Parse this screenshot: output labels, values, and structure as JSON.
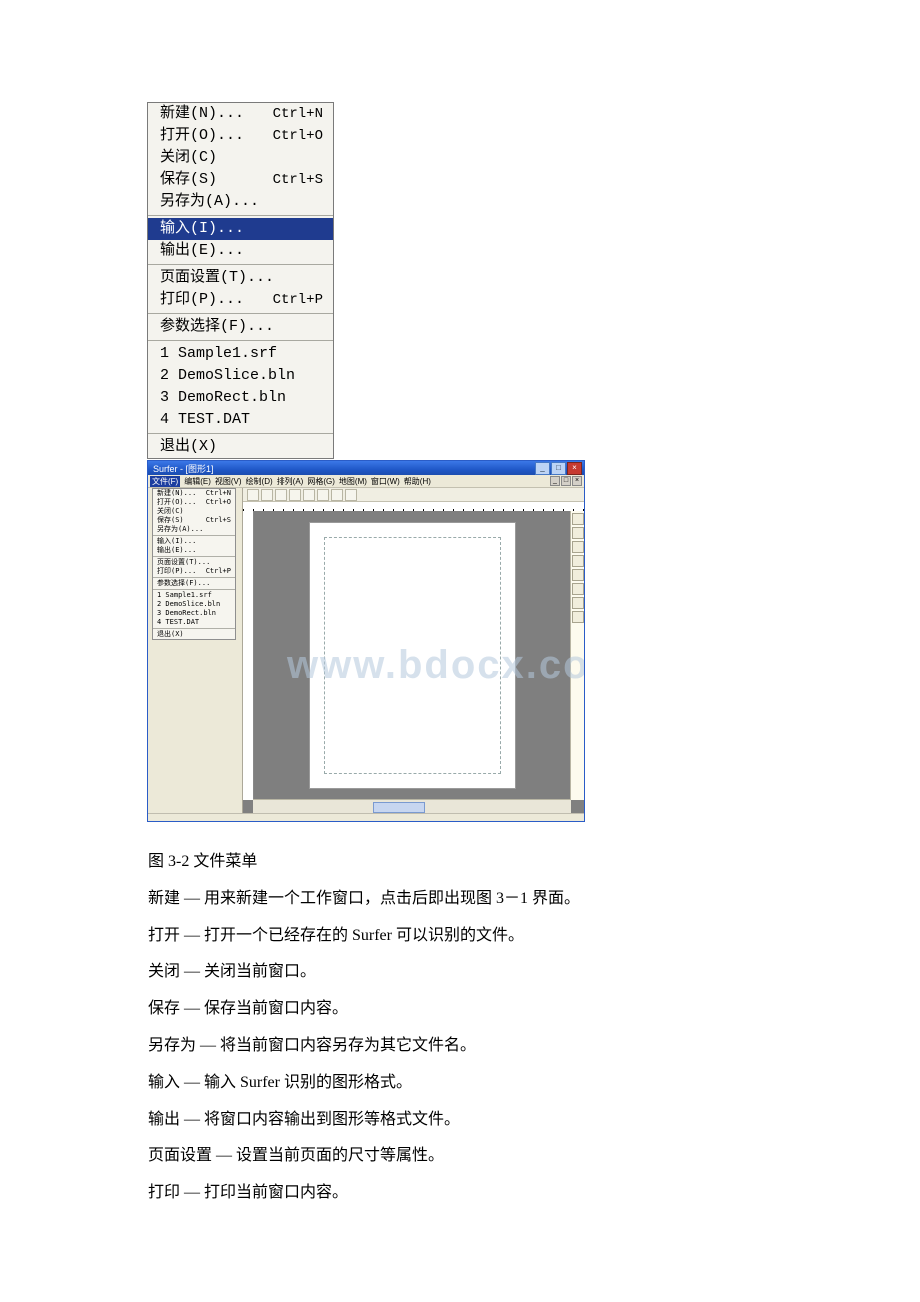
{
  "closeup_menu": {
    "new": {
      "label": "新建(N)...",
      "shortcut": "Ctrl+N"
    },
    "open": {
      "label": "打开(O)...",
      "shortcut": "Ctrl+O"
    },
    "close": {
      "label": "关闭(C)",
      "shortcut": ""
    },
    "save": {
      "label": "保存(S)",
      "shortcut": "Ctrl+S"
    },
    "saveas": {
      "label": "另存为(A)...",
      "shortcut": ""
    },
    "import": {
      "label": "输入(I)...",
      "shortcut": ""
    },
    "export": {
      "label": "输出(E)...",
      "shortcut": ""
    },
    "pagesetup": {
      "label": "页面设置(T)...",
      "shortcut": ""
    },
    "print": {
      "label": "打印(P)...",
      "shortcut": "Ctrl+P"
    },
    "prefs": {
      "label": "参数选择(F)...",
      "shortcut": ""
    },
    "recent1": {
      "label": "1 Sample1.srf"
    },
    "recent2": {
      "label": "2 DemoSlice.bln"
    },
    "recent3": {
      "label": "3 DemoRect.bln"
    },
    "recent4": {
      "label": "4 TEST.DAT"
    },
    "exit": {
      "label": "退出(X)"
    }
  },
  "app_window": {
    "title": "Surfer - [图形1]",
    "menubar": {
      "file": "文件(F)",
      "edit": "编辑(E)",
      "view": "视图(V)",
      "draw": "绘制(D)",
      "arrange": "排列(A)",
      "grid": "网格(G)",
      "map": "地图(M)",
      "window": "窗口(W)",
      "help": "帮助(H)"
    },
    "small_menu": {
      "new": {
        "label": "新建(N)...",
        "shortcut": "Ctrl+N"
      },
      "open": {
        "label": "打开(O)...",
        "shortcut": "Ctrl+O"
      },
      "close": {
        "label": "关闭(C)"
      },
      "save": {
        "label": "保存(S)",
        "shortcut": "Ctrl+S"
      },
      "saveas": {
        "label": "另存为(A)..."
      },
      "import": {
        "label": "输入(I)..."
      },
      "export": {
        "label": "输出(E)..."
      },
      "pagesetup": {
        "label": "页面设置(T)..."
      },
      "print": {
        "label": "打印(P)...",
        "shortcut": "Ctrl+P"
      },
      "prefs": {
        "label": "参数选择(F)..."
      },
      "recent1": {
        "label": "1 Sample1.srf"
      },
      "recent2": {
        "label": "2 DemoSlice.bln"
      },
      "recent3": {
        "label": "3 DemoRect.bln"
      },
      "recent4": {
        "label": "4 TEST.DAT"
      },
      "exit": {
        "label": "退出(X)"
      }
    },
    "watermark": "www.bdocx.com"
  },
  "body_text": {
    "caption": "图 3-2 文件菜单",
    "l_new": "新建 — 用来新建一个工作窗口，点击后即出现图 3－1 界面。",
    "l_open": "打开  — 打开一个已经存在的 Surfer 可以识别的文件。",
    "l_close": "关闭  — 关闭当前窗口。",
    "l_save": "保存 — 保存当前窗口内容。",
    "l_saveas": "另存为 — 将当前窗口内容另存为其它文件名。",
    "l_import": "输入  — 输入 Surfer 识别的图形格式。",
    "l_export": "输出  — 将窗口内容输出到图形等格式文件。",
    "l_pagesetup": "页面设置 — 设置当前页面的尺寸等属性。",
    "l_print": "打印 — 打印当前窗口内容。"
  }
}
